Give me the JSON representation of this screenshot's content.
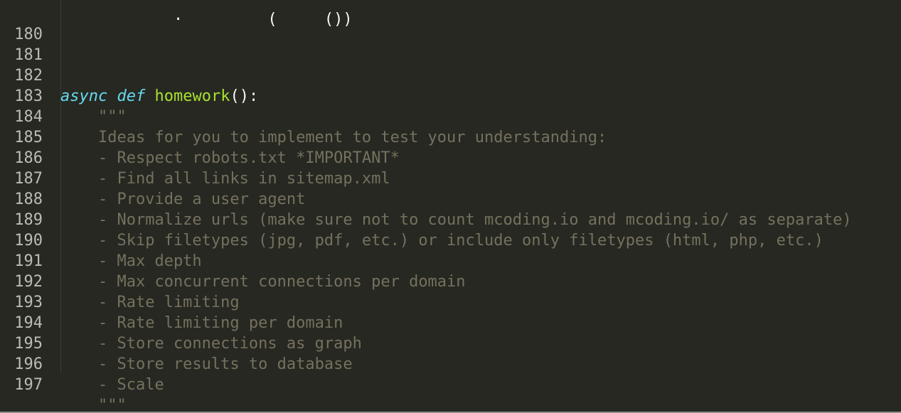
{
  "editor": {
    "partial_line": {
      "number": "",
      "text_white": "            j         (     ()) ",
      "text_orange": "             "
    },
    "lines": [
      {
        "number": "180",
        "text": ""
      },
      {
        "number": "181",
        "text": ""
      },
      {
        "number": "182",
        "async": "async",
        "def": "def",
        "name": "homework",
        "rest": "():"
      },
      {
        "number": "183",
        "text": "    \"\"\""
      },
      {
        "number": "184",
        "text": "    Ideas for you to implement to test your understanding:"
      },
      {
        "number": "185",
        "text": "    - Respect robots.txt *IMPORTANT*"
      },
      {
        "number": "186",
        "text": "    - Find all links in sitemap.xml"
      },
      {
        "number": "187",
        "text": "    - Provide a user agent"
      },
      {
        "number": "188",
        "text": "    - Normalize urls (make sure not to count mcoding.io and mcoding.io/ as separate)"
      },
      {
        "number": "189",
        "text": "    - Skip filetypes (jpg, pdf, etc.) or include only filetypes (html, php, etc.)"
      },
      {
        "number": "190",
        "text": "    - Max depth"
      },
      {
        "number": "191",
        "text": "    - Max concurrent connections per domain"
      },
      {
        "number": "192",
        "text": "    - Rate limiting"
      },
      {
        "number": "193",
        "text": "    - Rate limiting per domain"
      },
      {
        "number": "194",
        "text": "    - Store connections as graph"
      },
      {
        "number": "195",
        "text": "    - Store results to database"
      },
      {
        "number": "196",
        "text": "    - Scale"
      },
      {
        "number": "197",
        "text": "    \"\"\""
      }
    ]
  },
  "colors": {
    "background": "#272822",
    "line_number": "#bcbcb4",
    "keyword": "#66d9ef",
    "function_name": "#a6e22e",
    "docstring": "#75715e",
    "default_text": "#f8f8f2"
  }
}
